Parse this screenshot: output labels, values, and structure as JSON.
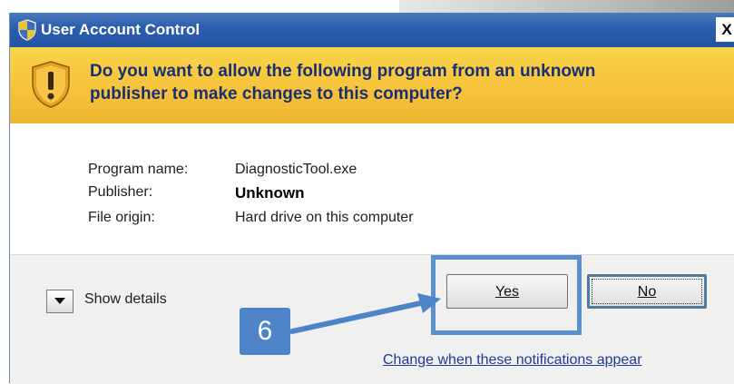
{
  "window": {
    "title": "User Account Control",
    "close_label": "X"
  },
  "banner": {
    "message": "Do you want to allow the following program from an unknown publisher to make changes to this computer?"
  },
  "details": {
    "program_name_label": "Program name:",
    "program_name_value": "DiagnosticTool.exe",
    "publisher_label": "Publisher:",
    "publisher_value": "Unknown",
    "file_origin_label": "File origin:",
    "file_origin_value": "Hard drive on this computer"
  },
  "footer": {
    "show_details_label": "Show details",
    "yes_label": "Yes",
    "no_label": "No",
    "change_link": "Change when these notifications appear"
  },
  "annotation": {
    "step_number": "6"
  },
  "colors": {
    "titlebar": "#2d5fae",
    "banner": "#f5c23a",
    "banner_text": "#1a2f73",
    "annotation": "#5b8fd0",
    "link": "#1f3a9c"
  },
  "icons": [
    "shield-icon",
    "warning-shield-icon",
    "close-icon",
    "dropdown-arrow-icon",
    "arrow-icon"
  ]
}
